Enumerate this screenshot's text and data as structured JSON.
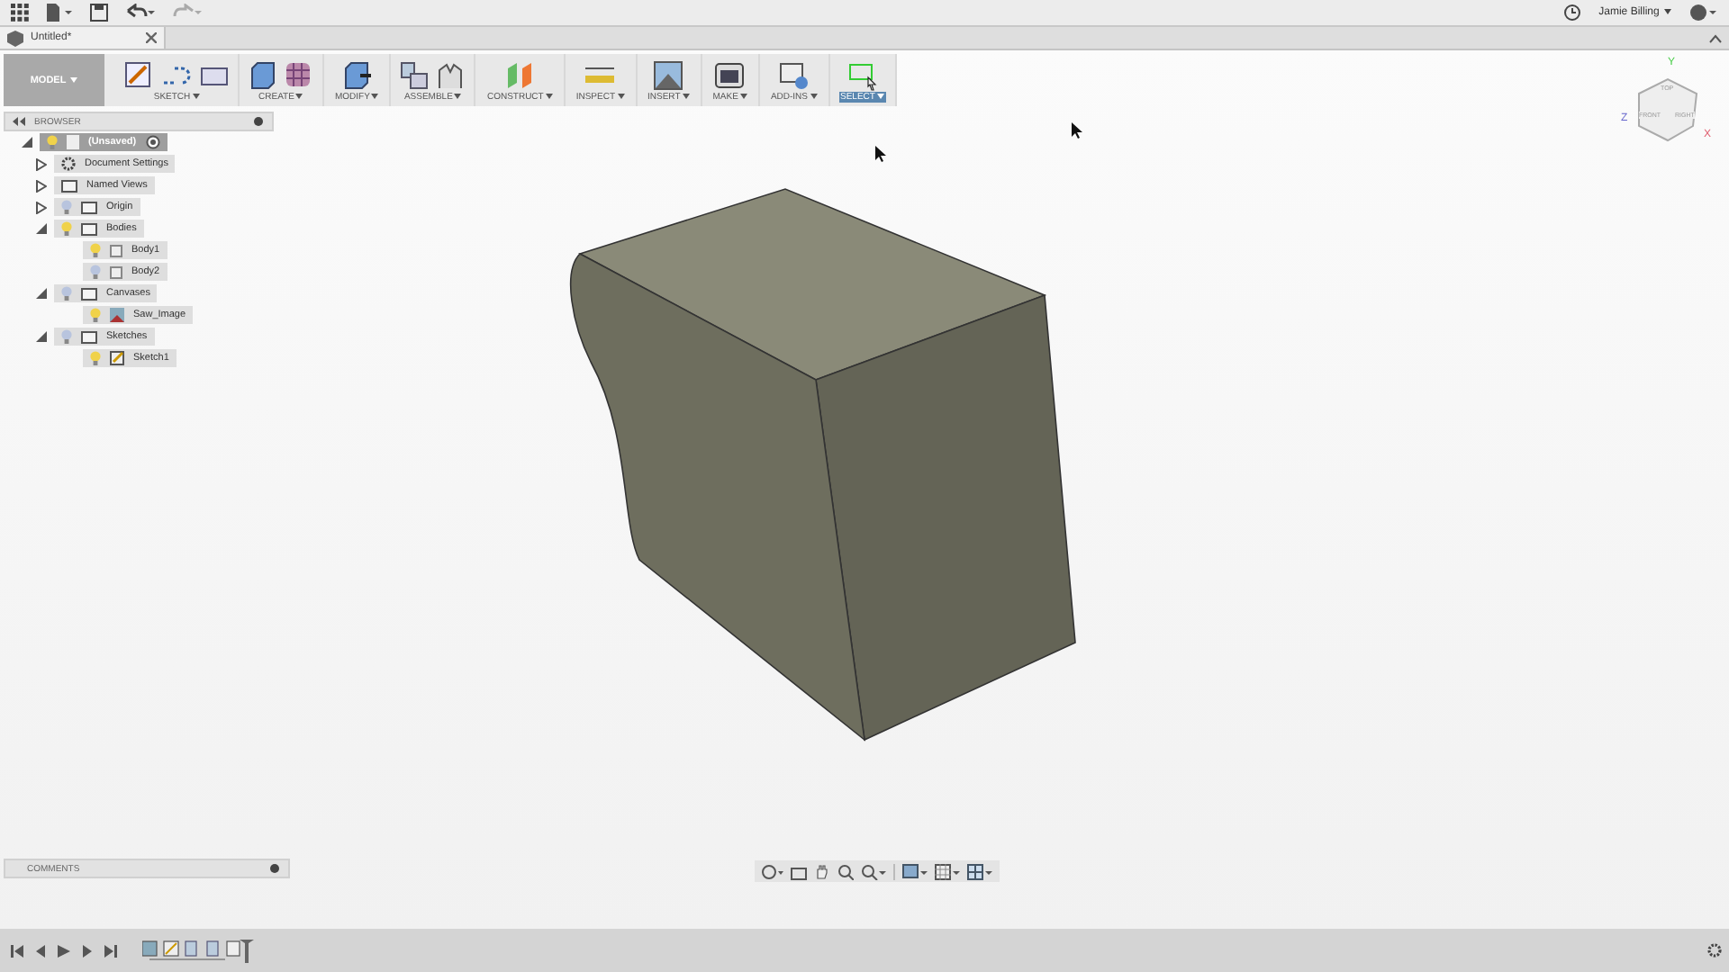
{
  "app_bar": {
    "user": "Jamie Billing"
  },
  "document_tab": {
    "title": "Untitled*"
  },
  "toolbar": {
    "workspace": "MODEL",
    "groups": [
      {
        "label": "SKETCH",
        "selected": false
      },
      {
        "label": "CREATE",
        "selected": false
      },
      {
        "label": "MODIFY",
        "selected": false
      },
      {
        "label": "ASSEMBLE",
        "selected": false
      },
      {
        "label": "CONSTRUCT",
        "selected": false
      },
      {
        "label": "INSPECT",
        "selected": false
      },
      {
        "label": "INSERT",
        "selected": false
      },
      {
        "label": "MAKE",
        "selected": false
      },
      {
        "label": "ADD-INS",
        "selected": false
      },
      {
        "label": "SELECT",
        "selected": true
      }
    ]
  },
  "browser": {
    "title": "BROWSER",
    "tree": [
      {
        "label": "(Unsaved)",
        "kind": "document",
        "visible": true,
        "expanded": true,
        "children": [
          {
            "label": "Document Settings",
            "kind": "settings",
            "expanded": false
          },
          {
            "label": "Named Views",
            "kind": "folder",
            "expanded": false
          },
          {
            "label": "Origin",
            "kind": "folder",
            "visible": false,
            "expanded": false
          },
          {
            "label": "Bodies",
            "kind": "folder",
            "visible": true,
            "expanded": true,
            "children": [
              {
                "label": "Body1",
                "kind": "body",
                "visible": true
              },
              {
                "label": "Body2",
                "kind": "body",
                "visible": false
              }
            ]
          },
          {
            "label": "Canvases",
            "kind": "folder",
            "visible": false,
            "expanded": true,
            "children": [
              {
                "label": "Saw_Image",
                "kind": "canvas",
                "visible": true
              }
            ]
          },
          {
            "label": "Sketches",
            "kind": "folder",
            "visible": false,
            "expanded": true,
            "children": [
              {
                "label": "Sketch1",
                "kind": "sketch",
                "visible": true
              }
            ]
          }
        ]
      }
    ]
  },
  "view_cube": {
    "faces": [
      "TOP",
      "FRONT",
      "RIGHT"
    ],
    "axes": [
      "X",
      "Y",
      "Z"
    ]
  },
  "comments": {
    "title": "COMMENTS"
  }
}
